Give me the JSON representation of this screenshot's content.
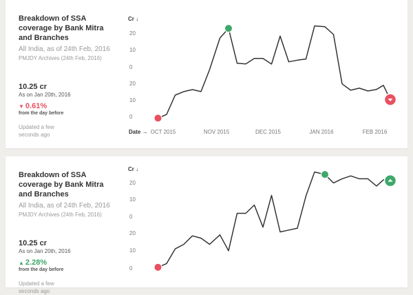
{
  "cards": [
    {
      "title": "Breakdown of SSA coverage by Bank Mitra and Branches",
      "subtitle": "All India, as of 24th Feb, 2016",
      "source": "PMJDY Archives (24th Feb, 2016)",
      "value": "10.25 cr",
      "as_of": "As on Jan 20th, 2016",
      "change": "0.61%",
      "change_dir": "down",
      "change_note": "from the day before",
      "updated": "Updated a few seconds ago"
    },
    {
      "title": "Breakdown of SSA coverage by Bank Mitra and Branches",
      "subtitle": "All India, as of 24th Feb, 2016",
      "source": "PMJDY Archives (24th Feb, 2016)",
      "value": "10.25 cr",
      "as_of": "As on Jan 20th, 2016",
      "change": "2.28%",
      "change_dir": "up",
      "change_note": "from the day before",
      "updated": "Updated a few seconds ago"
    }
  ],
  "colors": {
    "line": "#333333",
    "negative": "#e95160",
    "positive": "#3da86a",
    "grid_text": "#777777"
  },
  "chart_data": [
    {
      "type": "line",
      "ylabel": "Cr",
      "xlabel": "Date",
      "ytick_labels": [
        "20",
        "10",
        "0",
        "20",
        "10",
        "0"
      ],
      "xtick_labels": [
        "OCT 2015",
        "NOV 2015",
        "DEC 2015",
        "JAN 2016",
        "FEB 2016"
      ],
      "x_tick_dates": [
        "2015-10-01",
        "2015-11-01",
        "2015-12-01",
        "2016-01-01",
        "2016-02-01"
      ],
      "ylim": [
        0,
        50
      ],
      "grid": false,
      "x": [
        "2015-09-28",
        "2015-10-03",
        "2015-10-08",
        "2015-10-13",
        "2015-10-18",
        "2015-10-23",
        "2015-10-28",
        "2015-11-03",
        "2015-11-08",
        "2015-11-13",
        "2015-11-18",
        "2015-11-23",
        "2015-11-28",
        "2015-12-03",
        "2015-12-08",
        "2015-12-13",
        "2015-12-18",
        "2015-12-23",
        "2015-12-28",
        "2016-01-03",
        "2016-01-08",
        "2016-01-13",
        "2016-01-18",
        "2016-01-23",
        "2016-01-28",
        "2016-02-02",
        "2016-02-06",
        "2016-02-10"
      ],
      "values": [
        0.2,
        2.0,
        11.5,
        13.2,
        14.2,
        13.2,
        24.0,
        39.5,
        44.2,
        27.1,
        26.8,
        29.5,
        29.5,
        26.7,
        40.4,
        27.8,
        28.6,
        29.2,
        45.4,
        45.0,
        41.2,
        17.0,
        13.9,
        14.9,
        13.5,
        14.3,
        16.3,
        9.3
      ],
      "markers": [
        {
          "date": "2015-09-28",
          "value": 0.2,
          "kind": "low"
        },
        {
          "date": "2015-11-08",
          "value": 44.2,
          "kind": "high"
        },
        {
          "date": "2016-02-10",
          "value": 9.3,
          "kind": "last-down"
        }
      ]
    },
    {
      "type": "line",
      "ylabel": "Cr",
      "ytick_labels": [
        "20",
        "10",
        "0",
        "20",
        "10",
        "0"
      ],
      "ylim": [
        0,
        50
      ],
      "grid": false,
      "x": [
        "2015-09-28",
        "2015-10-03",
        "2015-10-08",
        "2015-10-13",
        "2015-10-18",
        "2015-10-23",
        "2015-10-28",
        "2015-11-03",
        "2015-11-08",
        "2015-11-13",
        "2015-11-18",
        "2015-11-23",
        "2015-11-28",
        "2015-12-03",
        "2015-12-08",
        "2015-12-13",
        "2015-12-18",
        "2015-12-23",
        "2015-12-28",
        "2016-01-03",
        "2016-01-08",
        "2016-01-13",
        "2016-01-18",
        "2016-01-23",
        "2016-01-28",
        "2016-02-02",
        "2016-02-06",
        "2016-02-10"
      ],
      "values": [
        1.4,
        3.2,
        10.3,
        12.5,
        16.6,
        15.5,
        12.5,
        17.1,
        9.4,
        27.5,
        27.5,
        31.5,
        20.8,
        36.2,
        18.5,
        19.4,
        20.3,
        35.9,
        47.5,
        46.3,
        42.2,
        44.2,
        45.6,
        44.2,
        44.2,
        40.7,
        43.7,
        43.3
      ],
      "markers": [
        {
          "date": "2015-09-28",
          "value": 1.4,
          "kind": "low"
        },
        {
          "date": "2016-01-03",
          "value": 46.3,
          "kind": "high"
        },
        {
          "date": "2016-02-10",
          "value": 43.3,
          "kind": "last-up"
        }
      ]
    }
  ]
}
